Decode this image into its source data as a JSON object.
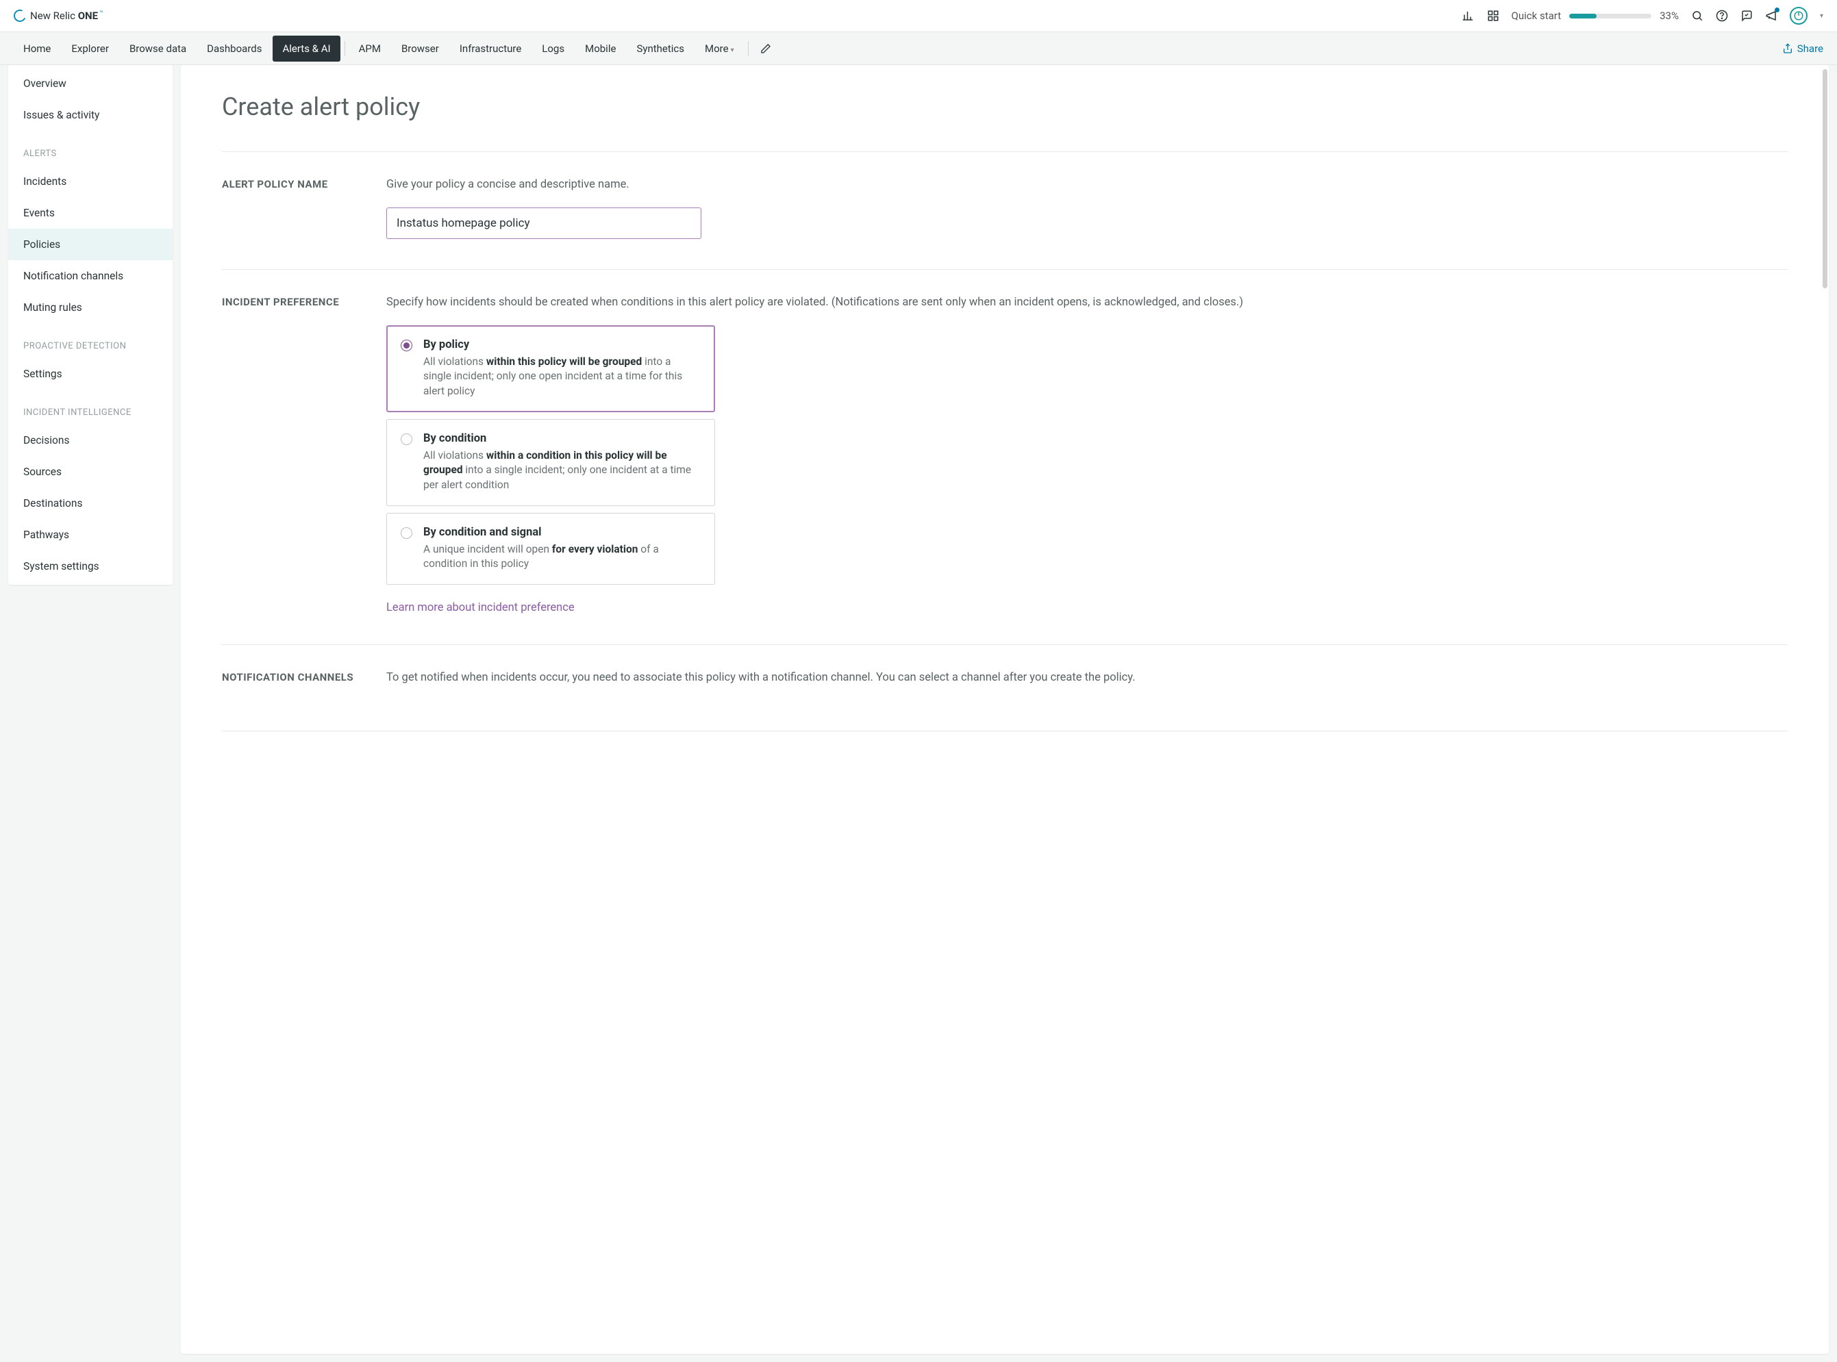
{
  "header": {
    "brand_prefix": "New Relic ",
    "brand_bold": "ONE",
    "brand_tm": "™",
    "quick_start_label": "Quick start",
    "progress_pct": 33,
    "progress_pct_label": "33%"
  },
  "nav": {
    "items": [
      "Home",
      "Explorer",
      "Browse data",
      "Dashboards",
      "Alerts & AI",
      "APM",
      "Browser",
      "Infrastructure",
      "Logs",
      "Mobile",
      "Synthetics",
      "More"
    ],
    "active_index": 4,
    "share_label": "Share"
  },
  "sidebar": {
    "top": [
      "Overview",
      "Issues & activity"
    ],
    "sections": [
      {
        "heading": "ALERTS",
        "items": [
          "Incidents",
          "Events",
          "Policies",
          "Notification channels",
          "Muting rules"
        ],
        "active_index": 2
      },
      {
        "heading": "PROACTIVE DETECTION",
        "items": [
          "Settings"
        ]
      },
      {
        "heading": "INCIDENT INTELLIGENCE",
        "items": [
          "Decisions",
          "Sources",
          "Destinations",
          "Pathways",
          "System settings"
        ]
      }
    ]
  },
  "page": {
    "title": "Create alert policy",
    "policy_name": {
      "label": "ALERT POLICY NAME",
      "help": "Give your policy a concise and descriptive name.",
      "value": "Instatus homepage policy"
    },
    "incident_pref": {
      "label": "INCIDENT PREFERENCE",
      "help": "Specify how incidents should be created when conditions in this alert policy are violated. (Notifications are sent only when an incident opens, is acknowledged, and closes.)",
      "options": [
        {
          "title": "By policy",
          "desc_pre": "All violations ",
          "desc_bold": "within this policy will be grouped",
          "desc_post": " into a single incident; only one open incident at a time for this alert policy"
        },
        {
          "title": "By condition",
          "desc_pre": "All violations ",
          "desc_bold": "within a condition in this policy will be grouped",
          "desc_post": " into a single incident; only one incident at a time per alert condition"
        },
        {
          "title": "By condition and signal",
          "desc_pre": "A unique incident will open ",
          "desc_bold": "for every violation",
          "desc_post": " of a condition in this policy"
        }
      ],
      "selected": 0,
      "learn_more": "Learn more about incident preference"
    },
    "notif_channels": {
      "label": "NOTIFICATION CHANNELS",
      "help": "To get notified when incidents occur, you need to associate this policy with a notification channel. You can select a channel after you create the policy."
    }
  }
}
